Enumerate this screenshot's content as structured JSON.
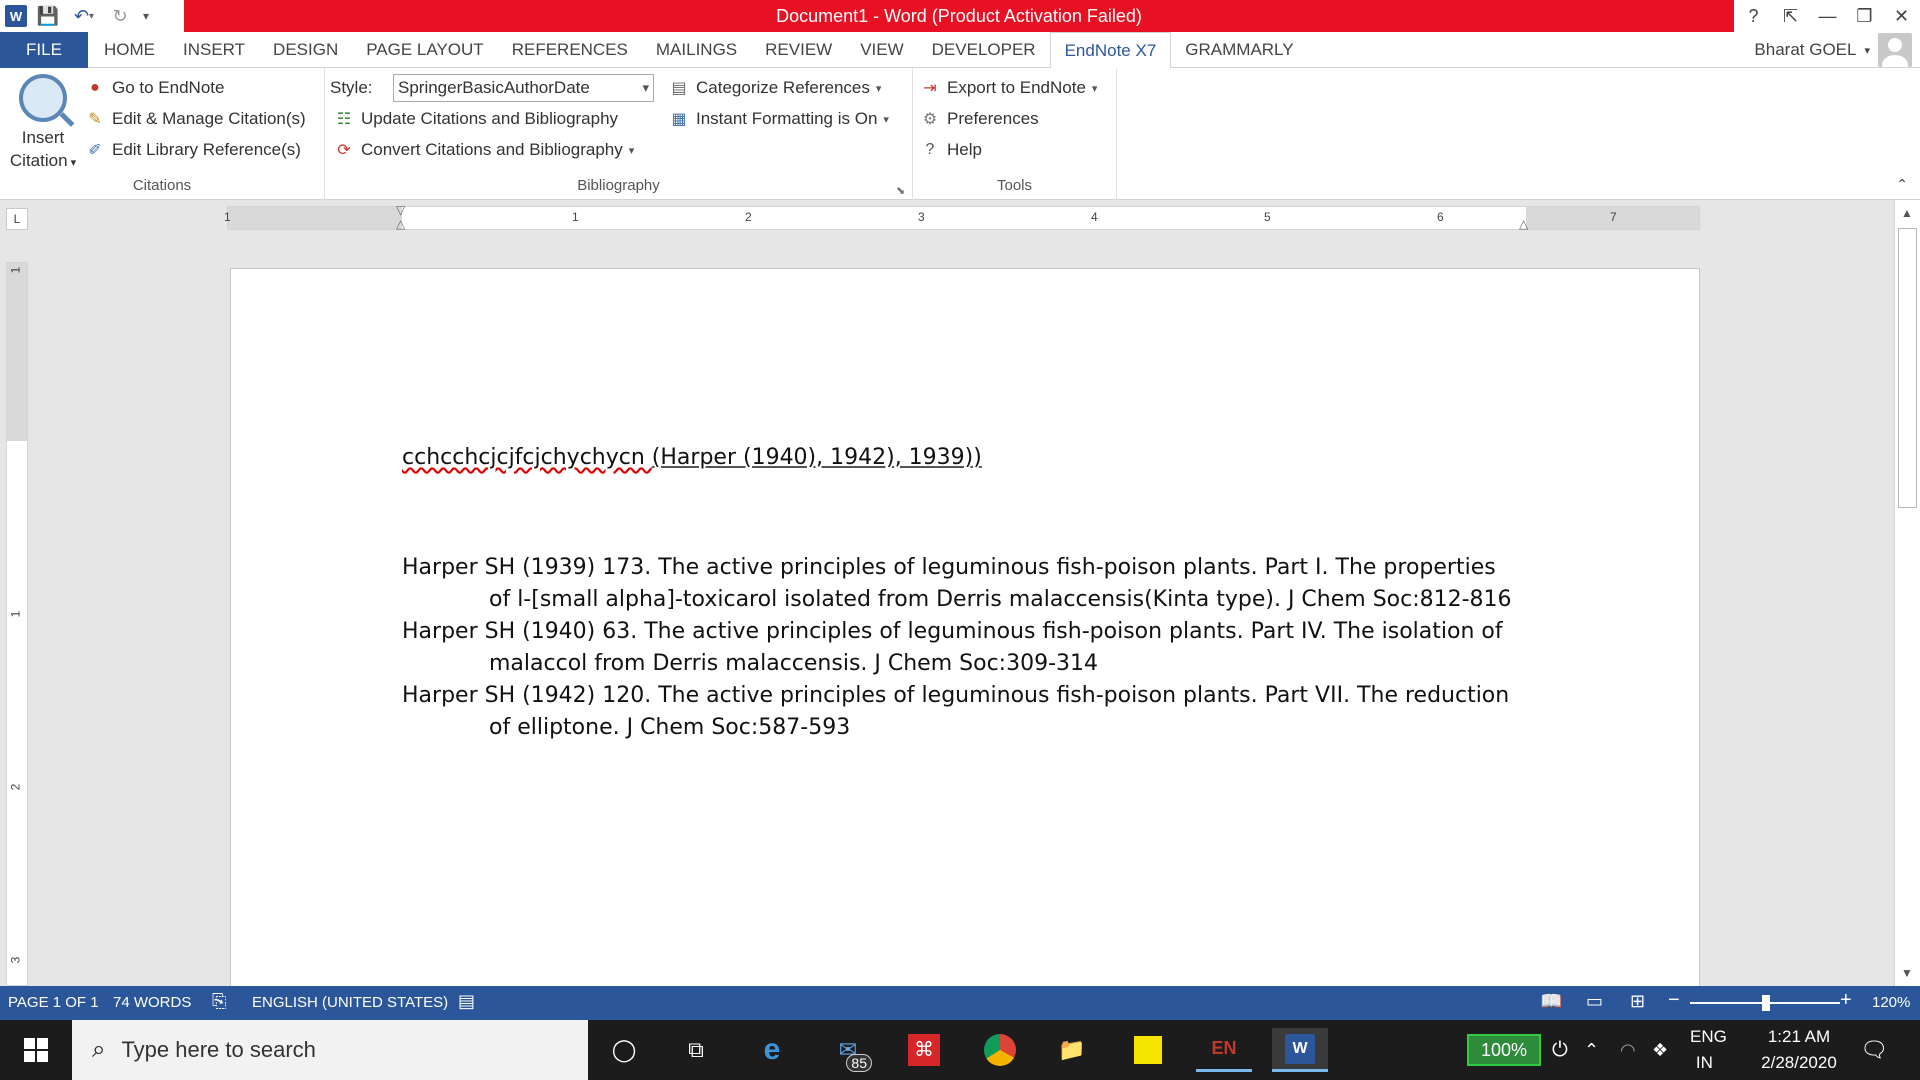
{
  "window": {
    "title": "Document1 -  Word (Product Activation Failed)",
    "controls": [
      "?",
      "⇱",
      "—",
      "❐",
      "✕"
    ]
  },
  "tabs": [
    "FILE",
    "HOME",
    "INSERT",
    "DESIGN",
    "PAGE LAYOUT",
    "REFERENCES",
    "MAILINGS",
    "REVIEW",
    "VIEW",
    "DEVELOPER",
    "EndNote X7",
    "GRAMMARLY"
  ],
  "user": {
    "name": "Bharat GOEL"
  },
  "ribbon": {
    "citations": {
      "label": "Citations",
      "insert_citation": "Insert",
      "insert_citation_2": "Citation",
      "go_to_endnote": "Go to EndNote",
      "edit_manage": "Edit & Manage Citation(s)",
      "edit_library": "Edit Library Reference(s)"
    },
    "bibliography": {
      "label": "Bibliography",
      "style_label": "Style:",
      "style_value": "SpringerBasicAuthorDate",
      "update": "Update Citations and Bibliography",
      "convert": "Convert Citations and Bibliography",
      "categorize": "Categorize References",
      "instant_formatting": "Instant Formatting is On"
    },
    "tools": {
      "label": "Tools",
      "export": "Export to EndNote",
      "preferences": "Preferences",
      "help": "Help"
    }
  },
  "ruler": {
    "h_numbers": [
      "1",
      "1",
      "2",
      "3",
      "4",
      "5",
      "6",
      "7"
    ],
    "v_numbers": [
      "1",
      "1",
      "2",
      "3"
    ],
    "tab_selector": "L"
  },
  "document": {
    "body_text": "cchcchcjcjfcjchychycn ",
    "citation": "(Harper (1940), 1942), 1939))",
    "bibliography": [
      "Harper SH (1939) 173. The active principles of leguminous fish-poison plants. Part I. The properties of l-[small alpha]-toxicarol isolated from Derris malaccensis(Kinta type). J Chem Soc:812-816",
      "Harper SH (1940) 63. The active principles of leguminous fish-poison plants. Part IV. The isolation of malaccol from Derris malaccensis. J Chem Soc:309-314",
      "Harper SH (1942) 120. The active principles of leguminous fish-poison plants. Part VII. The reduction of elliptone. J Chem Soc:587-593"
    ]
  },
  "statusbar": {
    "page": "PAGE 1 OF 1",
    "words": "74 WORDS",
    "language": "ENGLISH (UNITED STATES)",
    "zoom": "120%",
    "zoom_level_pct": 120
  },
  "taskbar": {
    "search_placeholder": "Type here to search",
    "mail_badge": "85",
    "battery": "100%",
    "lang_1": "ENG",
    "lang_2": "IN",
    "time": "1:21 AM",
    "date": "2/28/2020"
  }
}
